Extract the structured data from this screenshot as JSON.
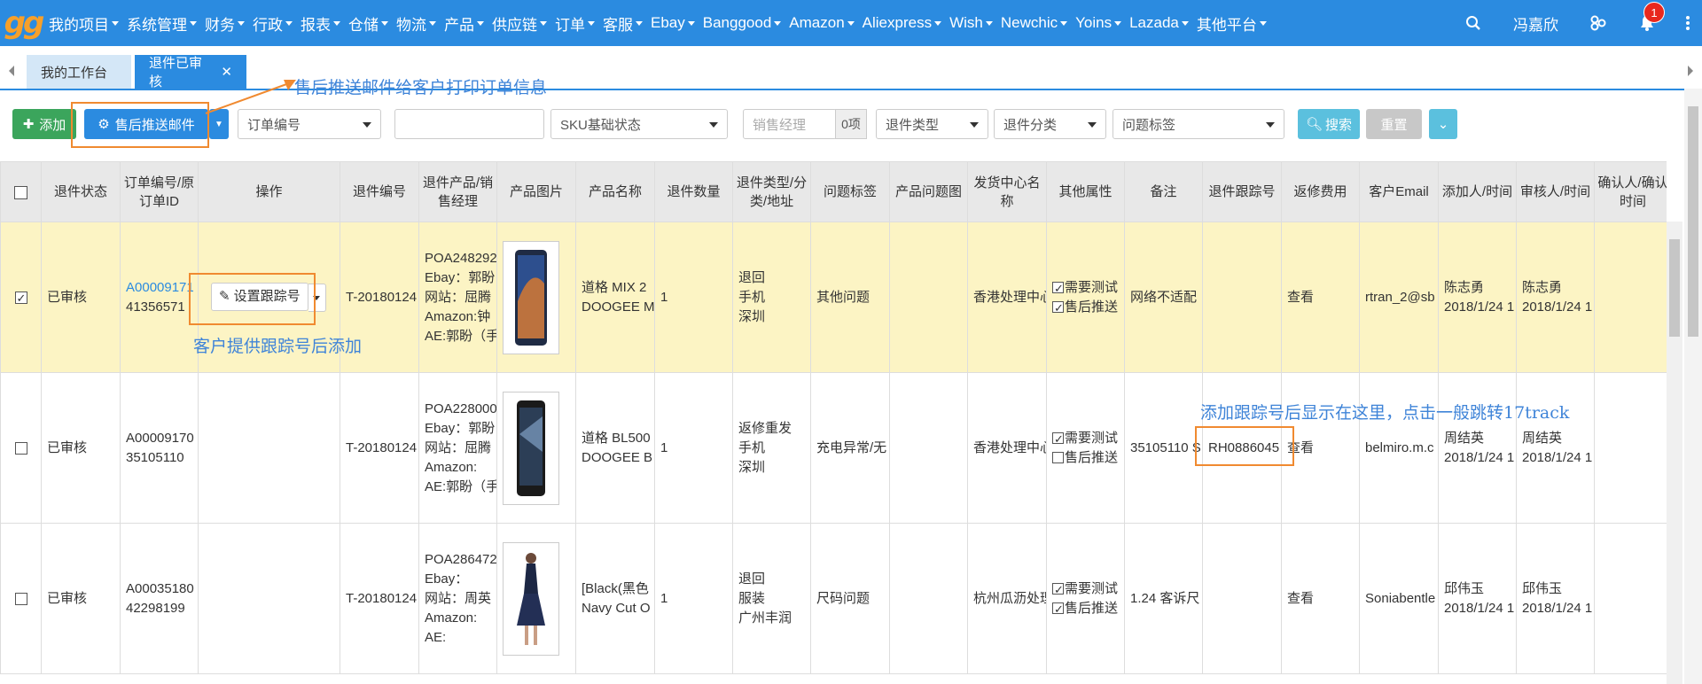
{
  "logo": "gg",
  "nav": {
    "items": [
      "我的项目",
      "系统管理",
      "财务",
      "行政",
      "报表",
      "仓储",
      "物流",
      "产品",
      "供应链",
      "订单",
      "客服",
      "Ebay",
      "Banggood",
      "Amazon",
      "Aliexpress",
      "Wish",
      "Newchic",
      "Yoins",
      "Lazada",
      "其他平台"
    ],
    "user": "冯嘉欣",
    "notifications": "1"
  },
  "tabs": {
    "home": "我的工作台",
    "active": "退件已审核"
  },
  "toolbar": {
    "add": "添加",
    "email": "售后推送邮件",
    "order_no": "订单编号",
    "sku_status": "SKU基础状态",
    "sales_manager_placeholder": "销售经理",
    "count": "0项",
    "return_type": "退件类型",
    "return_category": "退件分类",
    "issue_tag": "问题标签",
    "search": "搜索",
    "reset": "重置"
  },
  "table": {
    "headers": [
      "退件状态",
      "订单编号/原订单ID",
      "操作",
      "退件编号",
      "退件产品/销售经理",
      "产品图片",
      "产品名称",
      "退件数量",
      "退件类型/分类/地址",
      "问题标签",
      "产品问题图",
      "发货中心名称",
      "其他属性",
      "备注",
      "退件跟踪号",
      "返修费用",
      "客户Email",
      "添加人/时间",
      "审核人/时间",
      "确认人/确认时间"
    ],
    "set_tracking": "设置跟踪号",
    "rows": [
      {
        "checked": true,
        "status": "已审核",
        "order_no": "A00009171",
        "orig_id": "41356571",
        "return_no": "T-20180124",
        "product_lines": [
          "POA248292",
          "Ebay：郭盼",
          "网站：屈腾",
          "Amazon:钟",
          "AE:郭盼（手"
        ],
        "name_lines": [
          "道格 MIX 2",
          "DOOGEE M"
        ],
        "qty": "1",
        "type_lines": [
          "退回",
          "手机",
          "深圳"
        ],
        "issue": "其他问题",
        "center": "香港处理中心",
        "attr1": "需要测试",
        "attr2": "售后推送",
        "remark": "网络不适配",
        "tracking": "",
        "repair": "查看",
        "email": "rtran_2@sb",
        "adder": "陈志勇",
        "add_time": "2018/1/24 1",
        "reviewer": "陈志勇",
        "review_time": "2018/1/24 1"
      },
      {
        "checked": false,
        "status": "已审核",
        "order_no": "A00009170",
        "orig_id": "35105110",
        "return_no": "T-20180124",
        "product_lines": [
          "POA228000",
          "Ebay：郭盼",
          "网站：屈腾",
          "Amazon:",
          "AE:郭盼（手"
        ],
        "name_lines": [
          "道格 BL500",
          "DOOGEE B"
        ],
        "qty": "1",
        "type_lines": [
          "返修重发",
          "手机",
          "深圳"
        ],
        "issue": "充电异常/无",
        "center": "香港处理中心",
        "attr1": "需要测试",
        "attr2": "售后推送",
        "remark": "35105110 S",
        "tracking": "RH0886045",
        "repair": "查看",
        "email": "belmiro.m.c",
        "adder": "周结英",
        "add_time": "2018/1/24 1",
        "reviewer": "周结英",
        "review_time": "2018/1/24 1"
      },
      {
        "checked": false,
        "status": "已审核",
        "order_no": "A00035180",
        "orig_id": "42298199",
        "return_no": "T-20180124",
        "product_lines": [
          "POA286472",
          "Ebay：",
          "网站：周英",
          "Amazon:",
          "AE:"
        ],
        "name_lines": [
          "[Black(黑色",
          "Navy Cut O"
        ],
        "qty": "1",
        "type_lines": [
          "退回",
          "服装",
          "广州丰润"
        ],
        "issue": "尺码问题",
        "center": "杭州瓜沥处理",
        "attr1": "需要测试",
        "attr2": "售后推送",
        "remark": "1.24 客诉尺",
        "tracking": "",
        "repair": "查看",
        "email": "Soniabentle",
        "adder": "邱伟玉",
        "add_time": "2018/1/24 1",
        "reviewer": "邱伟玉",
        "review_time": "2018/1/24 1"
      }
    ]
  },
  "annotations": {
    "email": "售后推送邮件给客户打印订单信息",
    "tracking_add": "客户提供跟踪号后添加",
    "tracking_show": "添加跟踪号后显示在这里，点击一般跳转17track"
  }
}
